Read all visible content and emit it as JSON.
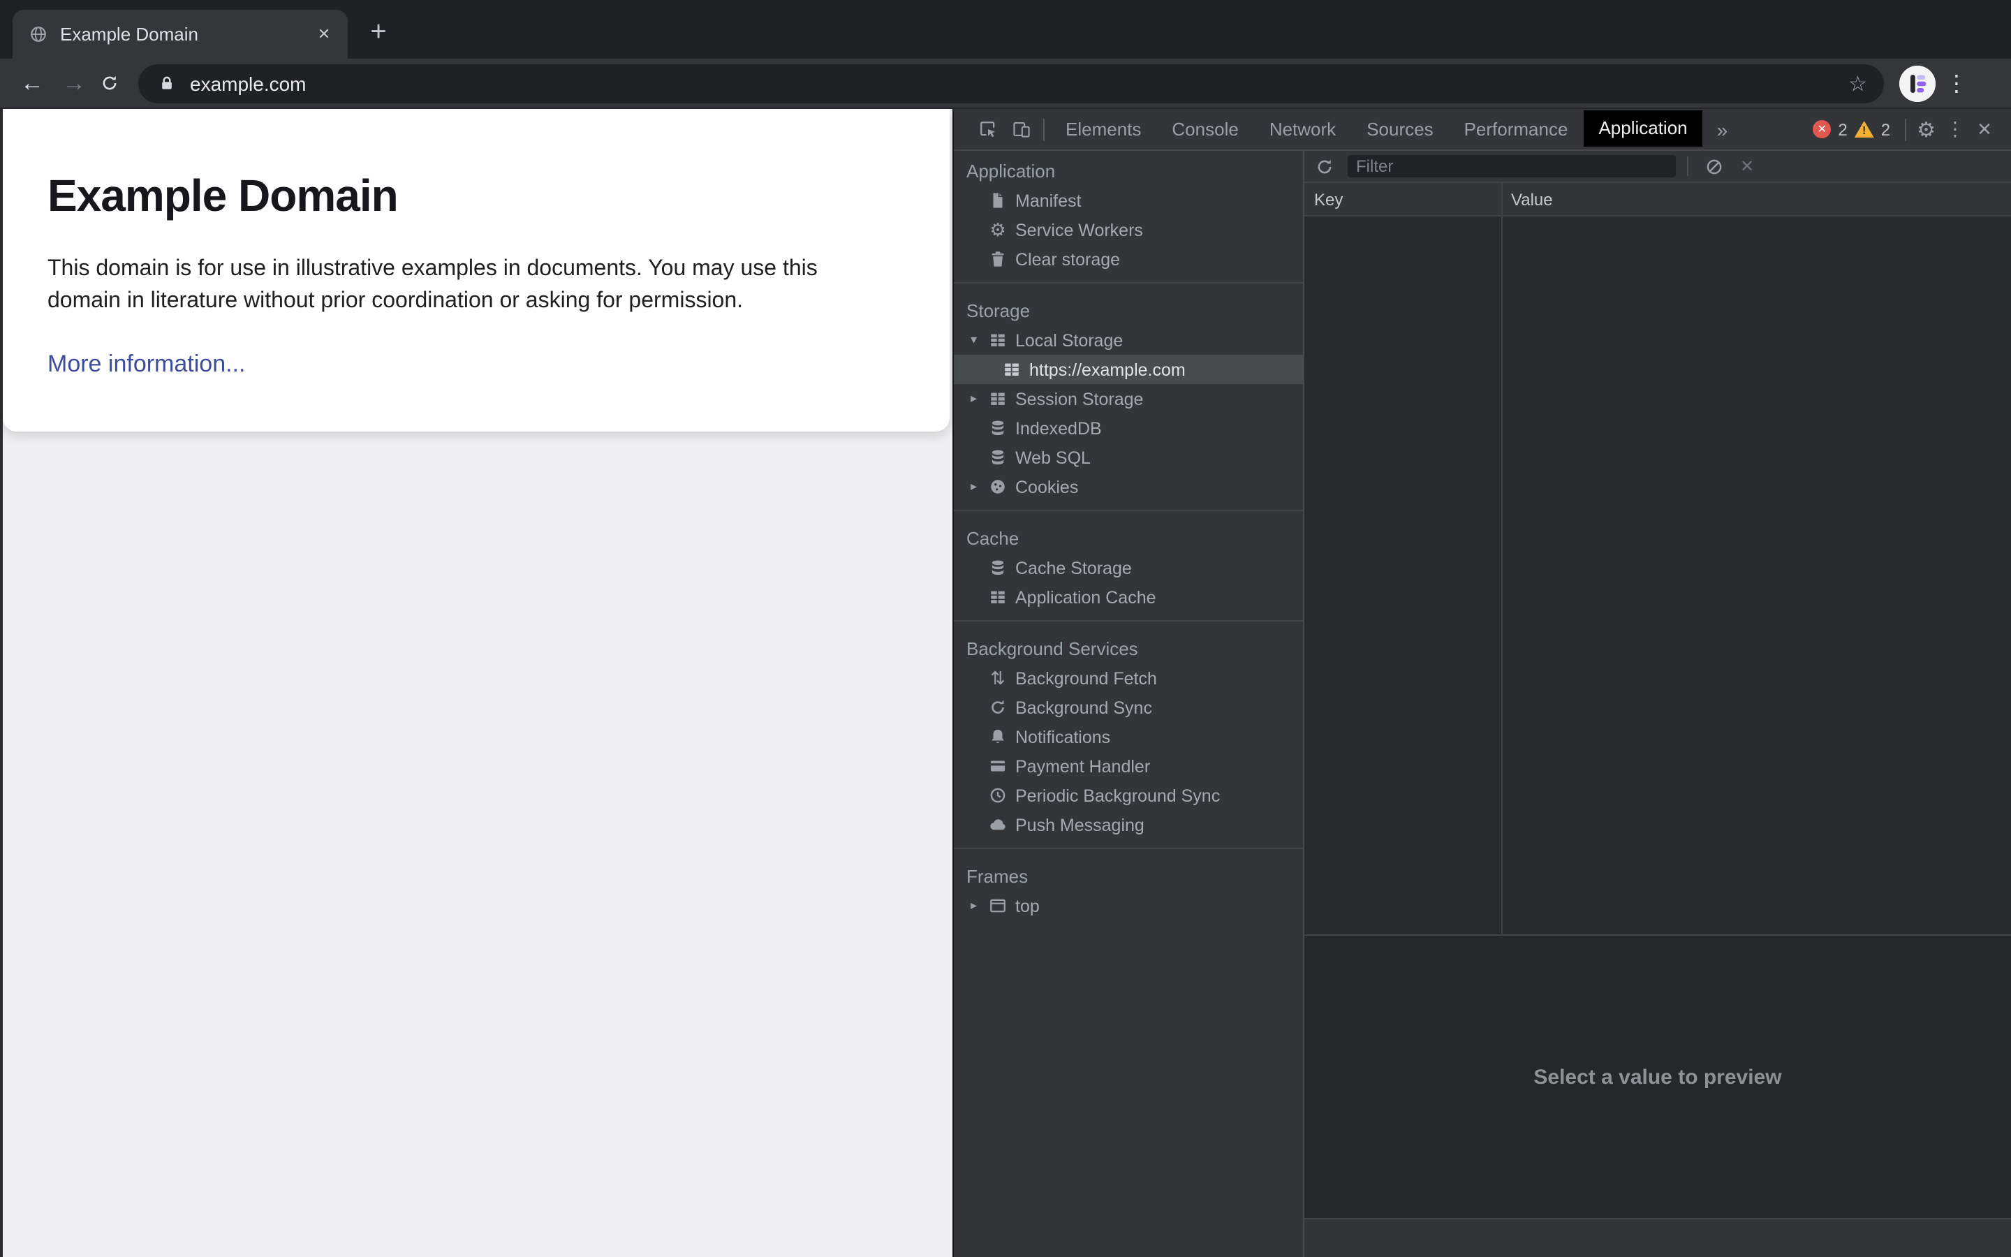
{
  "browser": {
    "tab_title": "Example Domain",
    "url": "example.com"
  },
  "glyphs": {
    "back": "←",
    "forward": "→",
    "plus": "+",
    "close": "✕",
    "menu_dots": "⋮",
    "star": "☆",
    "gear": "⚙",
    "updown": "⇅",
    "more_tabs": "»",
    "tri_down": "▾",
    "tri_right": "▸",
    "bang": "!"
  },
  "page": {
    "heading": "Example Domain",
    "body": "This domain is for use in illustrative examples in documents. You may use this domain in literature without prior coordination or asking for permission.",
    "link": "More information..."
  },
  "devtools": {
    "tabs": [
      {
        "label": "Elements"
      },
      {
        "label": "Console"
      },
      {
        "label": "Network"
      },
      {
        "label": "Sources"
      },
      {
        "label": "Performance"
      },
      {
        "label": "Application"
      }
    ],
    "active_tab": "Application",
    "error_count": "2",
    "warning_count": "2",
    "sidebar": {
      "sections": [
        {
          "title": "Application",
          "items": [
            {
              "label": "Manifest",
              "icon": "file"
            },
            {
              "label": "Service Workers",
              "icon": "gear"
            },
            {
              "label": "Clear storage",
              "icon": "trash"
            }
          ]
        },
        {
          "title": "Storage",
          "items": [
            {
              "label": "Local Storage",
              "icon": "table",
              "state": "expanded"
            },
            {
              "label": "https://example.com",
              "icon": "table",
              "state": "selected-child"
            },
            {
              "label": "Session Storage",
              "icon": "table",
              "state": "collapsed"
            },
            {
              "label": "IndexedDB",
              "icon": "database"
            },
            {
              "label": "Web SQL",
              "icon": "database"
            },
            {
              "label": "Cookies",
              "icon": "cookie",
              "state": "collapsed"
            }
          ]
        },
        {
          "title": "Cache",
          "items": [
            {
              "label": "Cache Storage",
              "icon": "database"
            },
            {
              "label": "Application Cache",
              "icon": "table"
            }
          ]
        },
        {
          "title": "Background Services",
          "items": [
            {
              "label": "Background Fetch",
              "icon": "updown-arrows"
            },
            {
              "label": "Background Sync",
              "icon": "sync"
            },
            {
              "label": "Notifications",
              "icon": "bell"
            },
            {
              "label": "Payment Handler",
              "icon": "credit-card"
            },
            {
              "label": "Periodic Background Sync",
              "icon": "clock"
            },
            {
              "label": "Push Messaging",
              "icon": "cloud"
            }
          ]
        },
        {
          "title": "Frames",
          "items": [
            {
              "label": "top",
              "icon": "frame",
              "state": "collapsed"
            }
          ]
        }
      ]
    },
    "storage_panel": {
      "filter_placeholder": "Filter",
      "columns": [
        {
          "label": "Key"
        },
        {
          "label": "Value"
        }
      ],
      "preview_hint": "Select a value to preview"
    }
  },
  "colors": {
    "accent_link": "#3d4d9b",
    "error_red": "#e0584f",
    "warning_yellow": "#f2b135",
    "avatar_purple": "#8e62ee",
    "avatar_purple_light": "#c9b9f4"
  }
}
